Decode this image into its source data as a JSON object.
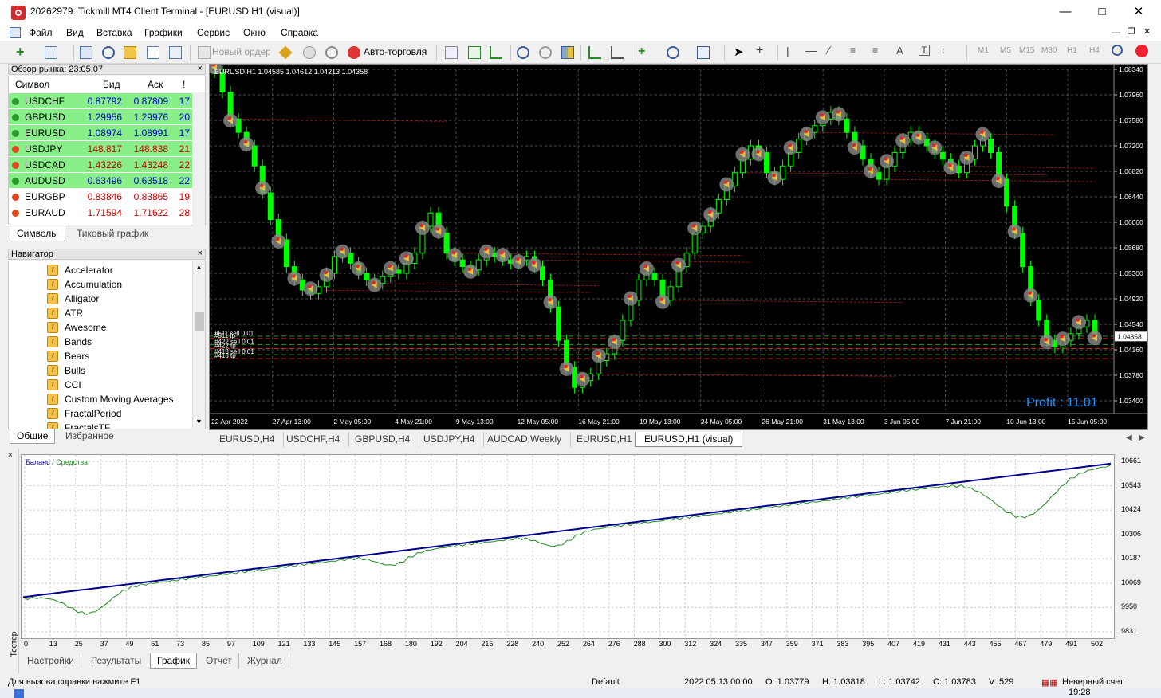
{
  "window": {
    "title": "20262979: Tickmill MT4 Client Terminal - [EURUSD,H1 (visual)]"
  },
  "menu": [
    "Файл",
    "Вид",
    "Вставка",
    "Графики",
    "Сервис",
    "Окно",
    "Справка"
  ],
  "toolbar": {
    "new_order": "Новый ордер",
    "autotrading": "Авто-торговля",
    "timeframes": [
      "M1",
      "M5",
      "M15",
      "M30",
      "H1",
      "H4"
    ]
  },
  "market_watch": {
    "title": "Обзор рынка: 23:05:07",
    "headers": {
      "symbol": "Символ",
      "bid": "Бид",
      "ask": "Аск",
      "spread": "!"
    },
    "rows": [
      {
        "symbol": "USDCHF",
        "bid": "0.87792",
        "ask": "0.87809",
        "spread": "17",
        "dir": "up"
      },
      {
        "symbol": "GBPUSD",
        "bid": "1.29956",
        "ask": "1.29976",
        "spread": "20",
        "dir": "up"
      },
      {
        "symbol": "EURUSD",
        "bid": "1.08974",
        "ask": "1.08991",
        "spread": "17",
        "dir": "up"
      },
      {
        "symbol": "USDJPY",
        "bid": "148.817",
        "ask": "148.838",
        "spread": "21",
        "dir": "down"
      },
      {
        "symbol": "USDCAD",
        "bid": "1.43226",
        "ask": "1.43248",
        "spread": "22",
        "dir": "down"
      },
      {
        "symbol": "AUDUSD",
        "bid": "0.63496",
        "ask": "0.63518",
        "spread": "22",
        "dir": "up"
      },
      {
        "symbol": "EURGBP",
        "bid": "0.83846",
        "ask": "0.83865",
        "spread": "19",
        "dir": "down"
      },
      {
        "symbol": "EURAUD",
        "bid": "1.71594",
        "ask": "1.71622",
        "spread": "28",
        "dir": "down"
      }
    ],
    "tabs": [
      "Символы",
      "Тиковый график"
    ]
  },
  "navigator": {
    "title": "Навигатор",
    "items": [
      "Accelerator",
      "Accumulation",
      "Alligator",
      "ATR",
      "Awesome",
      "Bands",
      "Bears",
      "Bulls",
      "CCI",
      "Custom Moving Averages",
      "FractalPeriod",
      "FractalsTF"
    ],
    "tabs": [
      "Общие",
      "Избранное"
    ]
  },
  "chart": {
    "header": "EURUSD,H1  1.04585 1.04612 1.04213 1.04358",
    "current_price": "1.04358",
    "price_levels": [
      "1.08340",
      "1.07960",
      "1.07580",
      "1.07200",
      "1.06820",
      "1.06440",
      "1.06060",
      "1.05680",
      "1.05300",
      "1.04920",
      "1.04540",
      "1.04160",
      "1.03780",
      "1.03400"
    ],
    "time_labels": [
      "22 Apr 2022",
      "27 Apr 13:00",
      "2 May 05:00",
      "4 May 21:00",
      "9 May 13:00",
      "12 May 05:00",
      "16 May 21:00",
      "19 May 13:00",
      "24 May 05:00",
      "26 May 21:00",
      "31 May 13:00",
      "3 Jun 05:00",
      "7 Jun 21:00",
      "10 Jun 13:00",
      "15 Jun 05:00"
    ],
    "order_labels": [
      "#511 sell 0.01",
      "#511 tp",
      "#422 sell 0.01",
      "#422 tp",
      "#418 sell 0.01",
      "#418 tp"
    ],
    "profit": "Profit : 11.01",
    "close_series": [
      1.083,
      1.08,
      1.076,
      1.074,
      1.072,
      1.069,
      1.065,
      1.061,
      1.058,
      1.054,
      1.052,
      1.0505,
      1.05,
      1.051,
      1.053,
      1.0555,
      1.056,
      1.0545,
      1.053,
      1.052,
      1.0515,
      1.0525,
      1.0535,
      1.053,
      1.0545,
      1.056,
      1.06,
      1.062,
      1.059,
      1.056,
      1.055,
      1.054,
      1.0535,
      1.055,
      1.056,
      1.0555,
      1.055,
      1.0545,
      1.055,
      1.0555,
      1.054,
      1.052,
      1.048,
      1.043,
      1.039,
      1.036,
      1.037,
      1.038,
      1.04,
      1.041,
      1.043,
      1.046,
      1.049,
      1.052,
      1.053,
      1.052,
      1.049,
      1.051,
      1.054,
      1.056,
      1.059,
      1.06,
      1.062,
      1.064,
      1.066,
      1.068,
      1.07,
      1.072,
      1.071,
      1.068,
      1.067,
      1.069,
      1.071,
      1.073,
      1.074,
      1.075,
      1.076,
      1.077,
      1.076,
      1.074,
      1.072,
      1.07,
      1.068,
      1.067,
      1.069,
      1.071,
      1.073,
      1.074,
      1.073,
      1.072,
      1.071,
      1.07,
      1.069,
      1.068,
      1.07,
      1.072,
      1.073,
      1.071,
      1.067,
      1.063,
      1.059,
      1.054,
      1.049,
      1.046,
      1.043,
      1.042,
      1.043,
      1.044,
      1.045,
      1.046,
      1.04358
    ]
  },
  "chart_tabs": [
    "EURUSD,H4",
    "USDCHF,H4",
    "GBPUSD,H4",
    "USDJPY,H4",
    "AUDCAD,Weekly",
    "EURUSD,H1",
    "EURUSD,H1 (visual)"
  ],
  "tester": {
    "side_label": "Тестер",
    "legend_balance": "Баланс",
    "legend_equity": "Средства",
    "y_labels": [
      "10661",
      "10543",
      "10424",
      "10306",
      "10187",
      "10069",
      "9950",
      "9831"
    ],
    "x_labels": [
      "0",
      "13",
      "25",
      "37",
      "49",
      "61",
      "73",
      "85",
      "97",
      "109",
      "121",
      "133",
      "145",
      "157",
      "168",
      "180",
      "192",
      "204",
      "216",
      "228",
      "240",
      "252",
      "264",
      "276",
      "288",
      "300",
      "312",
      "324",
      "335",
      "347",
      "359",
      "371",
      "383",
      "395",
      "407",
      "419",
      "431",
      "443",
      "455",
      "467",
      "479",
      "491",
      "502"
    ],
    "balance_range": [
      10000,
      10650
    ],
    "tabs": [
      "Настройки",
      "Результаты",
      "График",
      "Отчет",
      "Журнал"
    ]
  },
  "status": {
    "help": "Для вызова справки нажмите F1",
    "profile": "Default",
    "datetime": "2022.05.13 00:00",
    "open": "O: 1.03779",
    "high": "H: 1.03818",
    "low": "L: 1.03742",
    "close": "C: 1.03783",
    "volume": "V: 529",
    "connection": "Неверный счет",
    "clock": "19:28"
  },
  "colors": {
    "green_row": "#88ee88",
    "chart_bg": "#000000",
    "candle": "#00ff00",
    "balance": "#00008b",
    "equity": "#228b22",
    "profit": "#1e90ff"
  }
}
